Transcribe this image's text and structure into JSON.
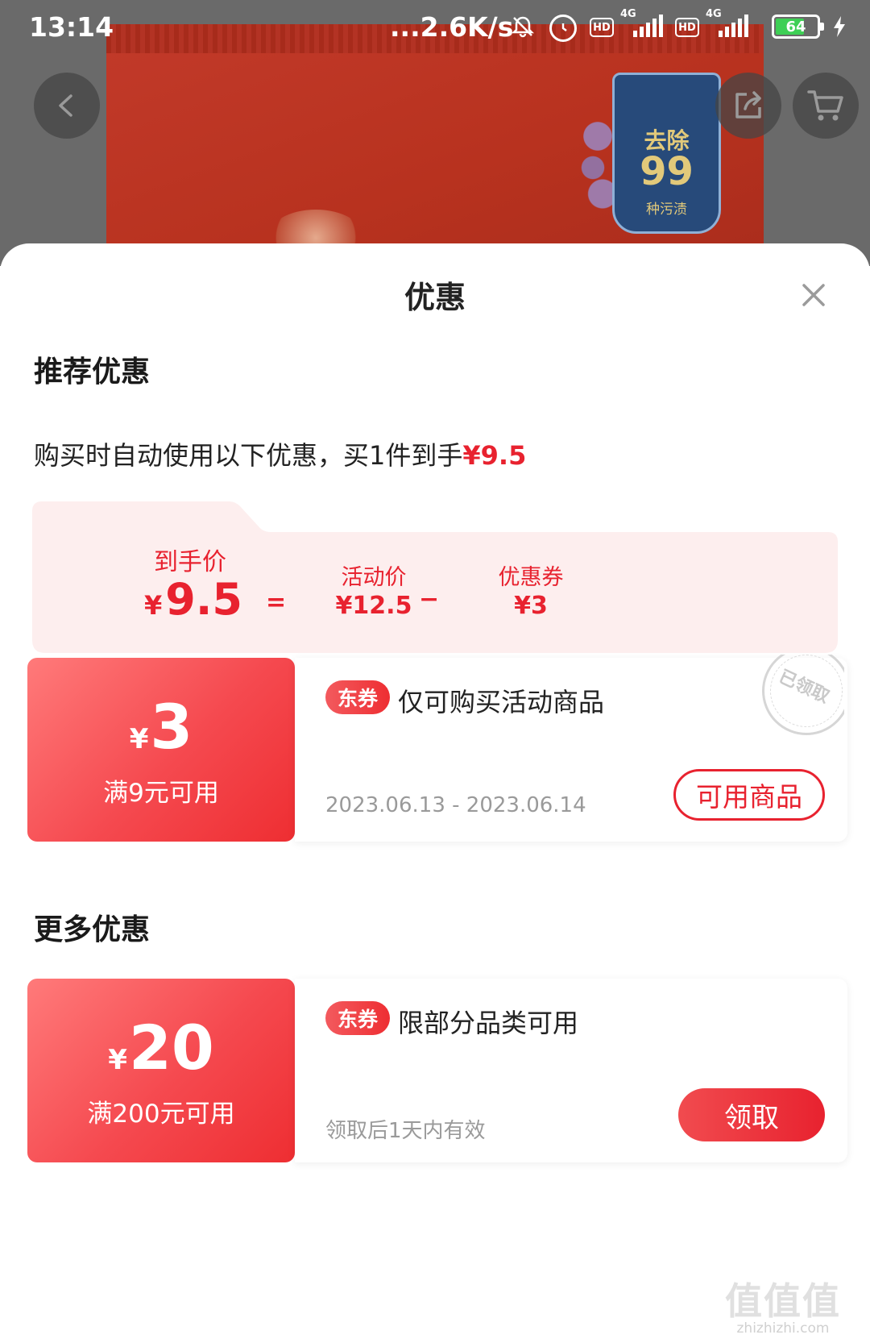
{
  "status_bar": {
    "time": "13:14",
    "net_speed": "...2.6K/s",
    "network_type_1": "4G",
    "network_type_2": "4G",
    "hd_label": "HD",
    "battery": "64"
  },
  "product_image": {
    "badge_line1": "去除",
    "badge_line2": "99",
    "badge_line3": "种污渍"
  },
  "icons": {
    "back": "back-arrow-icon",
    "share": "share-icon",
    "cart": "cart-icon",
    "close": "close-icon"
  },
  "sheet": {
    "title": "优惠",
    "recommend": {
      "section_title": "推荐优惠",
      "summary_text": "购买时自动使用以下优惠，买1件到手",
      "summary_price": "¥9.5"
    },
    "calc": {
      "final_label": "到手价",
      "final_currency": "¥",
      "final_value": "9.5",
      "equals": "=",
      "activity_label": "活动价",
      "activity_value": "¥12.5",
      "minus": "−",
      "coupon_label": "优惠券",
      "coupon_value": "¥3"
    },
    "coupon1": {
      "currency": "¥",
      "amount": "3",
      "condition": "满9元可用",
      "tag": "东券",
      "description": "仅可购买活动商品",
      "validity": "2023.06.13 - 2023.06.14",
      "button": "可用商品",
      "stamp": "已领取"
    },
    "more": {
      "section_title": "更多优惠"
    },
    "coupon2": {
      "currency": "¥",
      "amount": "20",
      "condition": "满200元可用",
      "tag": "东券",
      "description": "限部分品类可用",
      "validity": "领取后1天内有效",
      "button": "领取"
    }
  },
  "watermark": {
    "logo_text": "值值值",
    "site": "zhizhizhi.com"
  },
  "colors": {
    "accent_red": "#e8222f",
    "coupon_gradient_start": "#ff7a7a",
    "coupon_gradient_end": "#ee2e32",
    "calc_bg": "#fdeeee"
  }
}
